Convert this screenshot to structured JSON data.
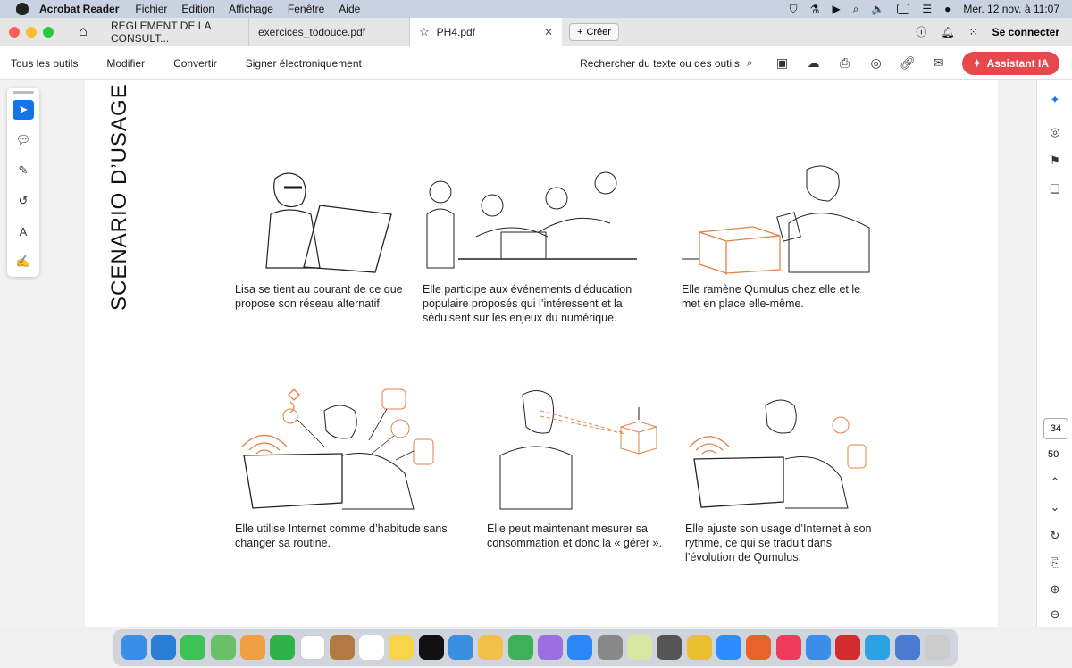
{
  "menubar": {
    "app": "Acrobat Reader",
    "items": [
      "Fichier",
      "Edition",
      "Affichage",
      "Fenêtre",
      "Aide"
    ],
    "clock": "Mer. 12 nov. à 11:07"
  },
  "tabs": {
    "tab1": "REGLEMENT DE LA CONSULT...",
    "tab2": "exercices_todouce.pdf",
    "active": "PH4.pdf",
    "create": "Créer",
    "login": "Se connecter"
  },
  "toolbar": {
    "all_tools": "Tous les outils",
    "edit": "Modifier",
    "convert": "Convertir",
    "sign": "Signer électroniquement",
    "search": "Rechercher du texte ou des outils",
    "assistant": "Assistant IA"
  },
  "document": {
    "title": "SCENARIO D’USAGE",
    "captions": [
      "Lisa se tient au courant de ce que propose son réseau alternatif.",
      "Elle participe aux événements d’éducation populaire proposés qui l’intéressent et la séduisent sur les enjeux du numérique.",
      "Elle ramène Qumulus chez elle et le met en place elle-même.",
      "Elle utilise Internet comme d’habitude sans changer sa routine.",
      "Elle peut maintenant mesurer sa consommation et donc la « gérer ».",
      "Elle ajuste son usage d’Internet à son rythme, ce qui se traduit dans l’évolution de Qumulus."
    ]
  },
  "pager": {
    "current": "34",
    "total": "50"
  },
  "colors": {
    "accent_blue": "#1473e6",
    "ai_red": "#e5484d",
    "illustration_orange": "#e0824a"
  }
}
